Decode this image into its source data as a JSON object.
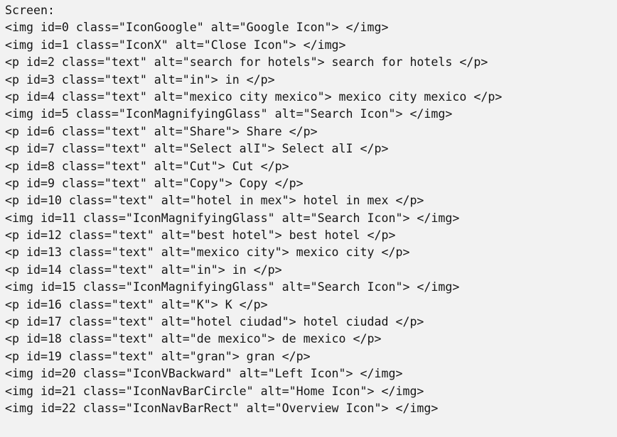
{
  "document": {
    "title": "Screen",
    "header_label": "Screen:",
    "background_color": "#f2f2f2",
    "text_color": "#151515",
    "element_count": 23
  },
  "elements": [
    {
      "id": 0,
      "tag": "img",
      "class": "IconGoogle",
      "alt": "Google Icon",
      "content": "",
      "line": "<img id=0 class=\"IconGoogle\" alt=\"Google Icon\"> </img>"
    },
    {
      "id": 1,
      "tag": "img",
      "class": "IconX",
      "alt": "Close Icon",
      "content": "",
      "line": "<img id=1 class=\"IconX\" alt=\"Close Icon\"> </img>"
    },
    {
      "id": 2,
      "tag": "p",
      "class": "text",
      "alt": "search for hotels",
      "content": "search for hotels",
      "line": "<p id=2 class=\"text\" alt=\"search for hotels\"> search for hotels </p>"
    },
    {
      "id": 3,
      "tag": "p",
      "class": "text",
      "alt": "in",
      "content": "in",
      "line": "<p id=3 class=\"text\" alt=\"in\"> in </p>"
    },
    {
      "id": 4,
      "tag": "p",
      "class": "text",
      "alt": "mexico city mexico",
      "content": "mexico city mexico",
      "line": "<p id=4 class=\"text\" alt=\"mexico city mexico\"> mexico city mexico </p>"
    },
    {
      "id": 5,
      "tag": "img",
      "class": "IconMagnifyingGlass",
      "alt": "Search Icon",
      "content": "",
      "line": "<img id=5 class=\"IconMagnifyingGlass\" alt=\"Search Icon\"> </img>"
    },
    {
      "id": 6,
      "tag": "p",
      "class": "text",
      "alt": "Share",
      "content": "Share",
      "line": "<p id=6 class=\"text\" alt=\"Share\"> Share </p>"
    },
    {
      "id": 7,
      "tag": "p",
      "class": "text",
      "alt": "Select alI",
      "content": "Select alI",
      "line": "<p id=7 class=\"text\" alt=\"Select alI\"> Select alI </p>"
    },
    {
      "id": 8,
      "tag": "p",
      "class": "text",
      "alt": "Cut",
      "content": "Cut",
      "line": "<p id=8 class=\"text\" alt=\"Cut\"> Cut </p>"
    },
    {
      "id": 9,
      "tag": "p",
      "class": "text",
      "alt": "Copy",
      "content": "Copy",
      "line": "<p id=9 class=\"text\" alt=\"Copy\"> Copy </p>"
    },
    {
      "id": 10,
      "tag": "p",
      "class": "text",
      "alt": "hotel in mex",
      "content": "hotel in mex",
      "line": "<p id=10 class=\"text\" alt=\"hotel in mex\"> hotel in mex </p>"
    },
    {
      "id": 11,
      "tag": "img",
      "class": "IconMagnifyingGlass",
      "alt": "Search Icon",
      "content": "",
      "line": "<img id=11 class=\"IconMagnifyingGlass\" alt=\"Search Icon\"> </img>"
    },
    {
      "id": 12,
      "tag": "p",
      "class": "text",
      "alt": "best hotel",
      "content": "best hotel",
      "line": "<p id=12 class=\"text\" alt=\"best hotel\"> best hotel </p>"
    },
    {
      "id": 13,
      "tag": "p",
      "class": "text",
      "alt": "mexico city",
      "content": "mexico city",
      "line": "<p id=13 class=\"text\" alt=\"mexico city\"> mexico city </p>"
    },
    {
      "id": 14,
      "tag": "p",
      "class": "text",
      "alt": "in",
      "content": "in",
      "line": "<p id=14 class=\"text\" alt=\"in\"> in </p>"
    },
    {
      "id": 15,
      "tag": "img",
      "class": "IconMagnifyingGlass",
      "alt": "Search Icon",
      "content": "",
      "line": "<img id=15 class=\"IconMagnifyingGlass\" alt=\"Search Icon\"> </img>"
    },
    {
      "id": 16,
      "tag": "p",
      "class": "text",
      "alt": "K",
      "content": "K",
      "line": "<p id=16 class=\"text\" alt=\"K\"> K </p>"
    },
    {
      "id": 17,
      "tag": "p",
      "class": "text",
      "alt": "hotel ciudad",
      "content": "hotel ciudad",
      "line": "<p id=17 class=\"text\" alt=\"hotel ciudad\"> hotel ciudad </p>"
    },
    {
      "id": 18,
      "tag": "p",
      "class": "text",
      "alt": "de mexico",
      "content": "de mexico",
      "line": "<p id=18 class=\"text\" alt=\"de mexico\"> de mexico </p>"
    },
    {
      "id": 19,
      "tag": "p",
      "class": "text",
      "alt": "gran",
      "content": "gran",
      "line": "<p id=19 class=\"text\" alt=\"gran\"> gran </p>"
    },
    {
      "id": 20,
      "tag": "img",
      "class": "IconVBackward",
      "alt": "Left Icon",
      "content": "",
      "line": "<img id=20 class=\"IconVBackward\" alt=\"Left Icon\"> </img>"
    },
    {
      "id": 21,
      "tag": "img",
      "class": "IconNavBarCircle",
      "alt": "Home Icon",
      "content": "",
      "line": "<img id=21 class=\"IconNavBarCircle\" alt=\"Home Icon\"> </img>"
    },
    {
      "id": 22,
      "tag": "img",
      "class": "IconNavBarRect",
      "alt": "Overview Icon",
      "content": "",
      "line": "<img id=22 class=\"IconNavBarRect\" alt=\"Overview Icon\"> </img>"
    }
  ]
}
